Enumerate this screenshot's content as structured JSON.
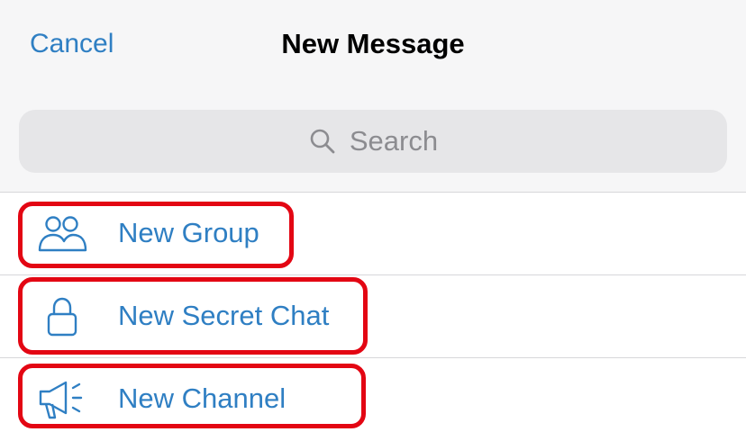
{
  "header": {
    "cancel_label": "Cancel",
    "title": "New Message"
  },
  "search": {
    "placeholder": "Search",
    "icon": "search-icon"
  },
  "menu": {
    "items": [
      {
        "label": "New Group",
        "icon": "group-icon"
      },
      {
        "label": "New Secret Chat",
        "icon": "lock-icon"
      },
      {
        "label": "New Channel",
        "icon": "megaphone-icon"
      }
    ]
  },
  "colors": {
    "accent": "#2f7fc3",
    "highlight": "#e30613",
    "header_bg": "#f6f6f7",
    "search_bg": "#e6e6e8"
  }
}
